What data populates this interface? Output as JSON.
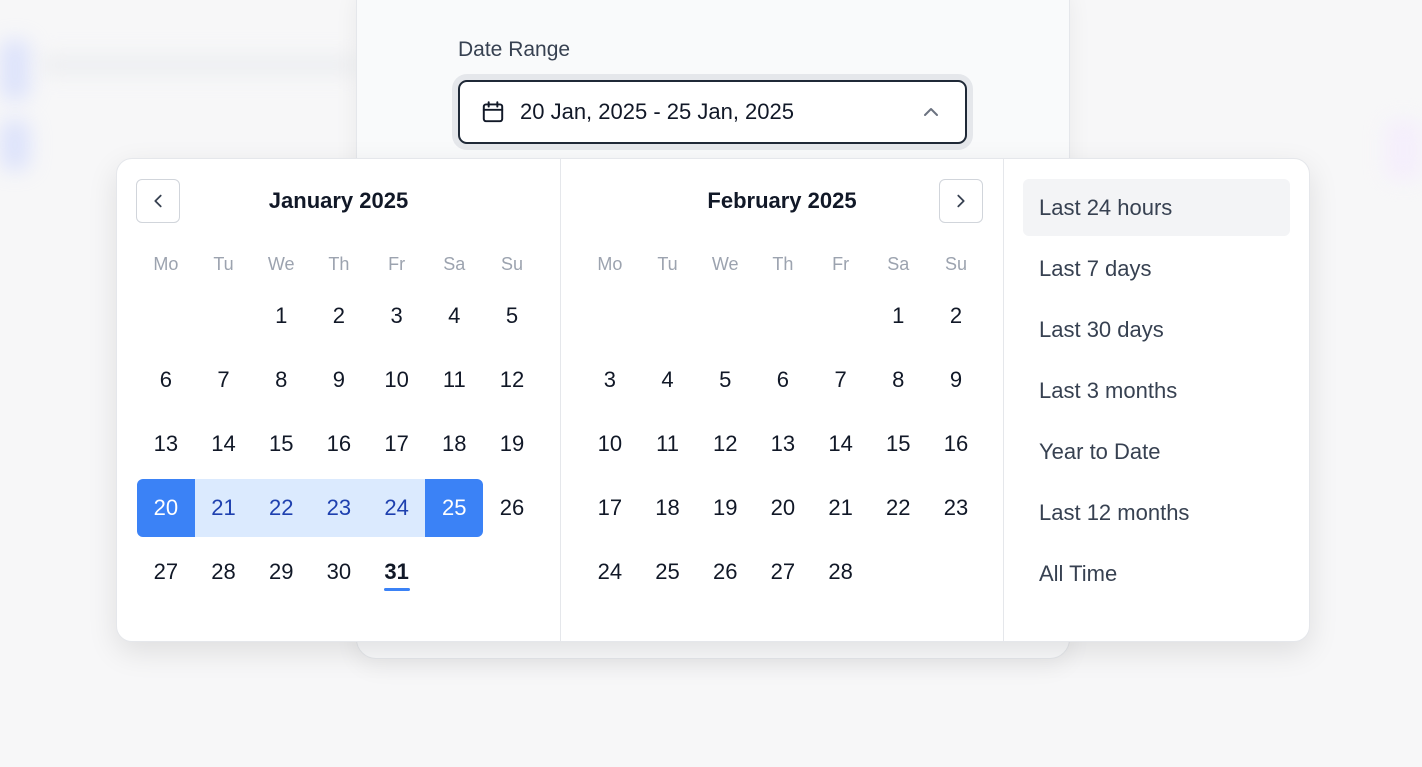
{
  "field": {
    "label": "Date Range",
    "value": "20 Jan, 2025 - 25 Jan, 2025"
  },
  "weekdays": [
    "Mo",
    "Tu",
    "We",
    "Th",
    "Fr",
    "Sa",
    "Su"
  ],
  "months": [
    {
      "title": "January 2025",
      "leading_blanks": 2,
      "days": 31,
      "range_start": 20,
      "range_end": 25,
      "today": 31
    },
    {
      "title": "February 2025",
      "leading_blanks": 5,
      "days": 28
    }
  ],
  "presets": [
    {
      "label": "Last 24 hours",
      "active": true
    },
    {
      "label": "Last 7 days"
    },
    {
      "label": "Last 30 days"
    },
    {
      "label": "Last 3 months"
    },
    {
      "label": "Year to Date"
    },
    {
      "label": "Last 12 months"
    },
    {
      "label": "All Time"
    }
  ],
  "colors": {
    "accent": "#3b82f6",
    "range_fill": "#dbeafe",
    "today_underline": "#3b82f6"
  },
  "icons": {
    "calendar": "calendar-icon",
    "chevron_up": "chevron-up-icon",
    "prev": "chevron-left-icon",
    "next": "chevron-right-icon"
  }
}
